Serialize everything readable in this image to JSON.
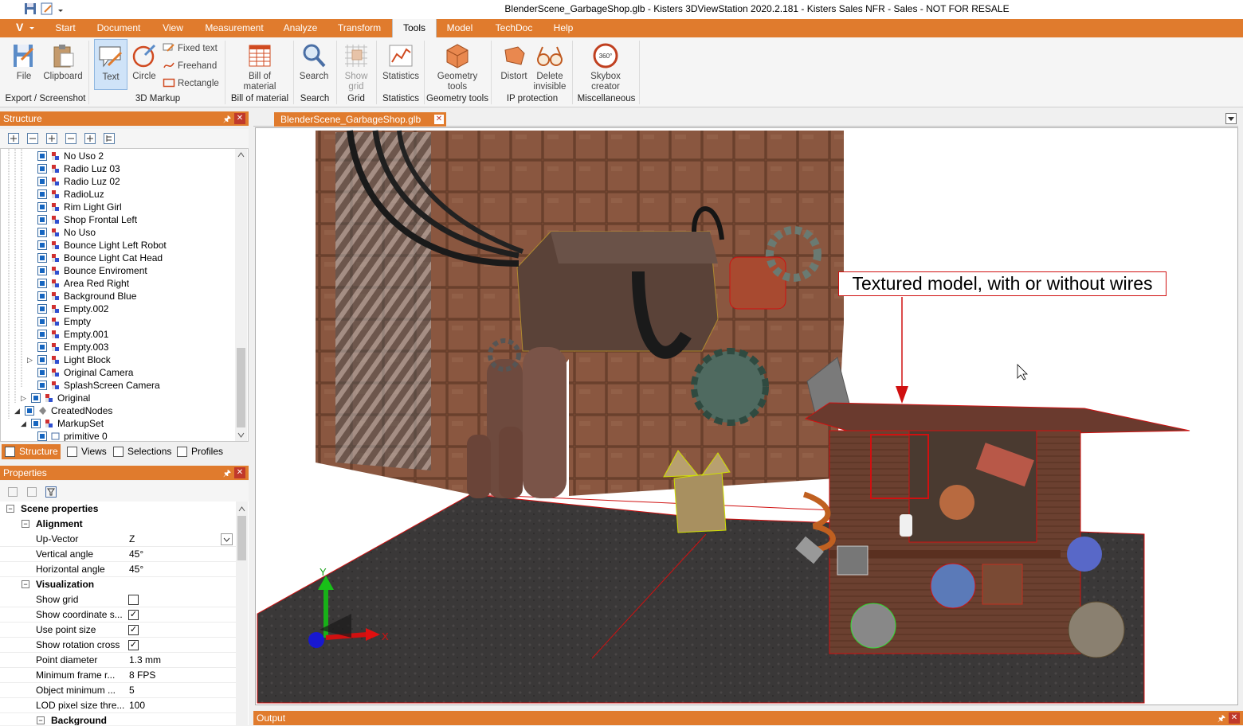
{
  "window": {
    "title": "BlenderScene_GarbageShop.glb - Kisters 3DViewStation 2020.2.181 - Kisters Sales NFR - Sales - NOT FOR RESALE"
  },
  "ribbon_tabs": [
    "Start",
    "Document",
    "View",
    "Measurement",
    "Analyze",
    "Transform",
    "Tools",
    "Model",
    "TechDoc",
    "Help"
  ],
  "app_button": "V",
  "ribbon": {
    "file": "File",
    "clipboard": "Clipboard",
    "text": "Text",
    "circle": "Circle",
    "fixed_text": "Fixed text",
    "freehand": "Freehand",
    "rectangle": "Rectangle",
    "bill_line1": "Bill of",
    "bill_line2": "material",
    "search": "Search",
    "show_grid_line1": "Show",
    "show_grid_line2": "grid",
    "statistics": "Statistics",
    "geom_line1": "Geometry",
    "geom_line2": "tools",
    "distort": "Distort",
    "delete_line1": "Delete",
    "delete_line2": "invisible",
    "skybox_line1": "Skybox",
    "skybox_line2": "creator",
    "groups": {
      "export": "Export / Screenshot",
      "markup": "3D Markup",
      "bill": "Bill of material",
      "search": "Search",
      "grid": "Grid",
      "statistics": "Statistics",
      "geometry": "Geometry tools",
      "ip": "IP protection",
      "misc": "Miscellaneous"
    }
  },
  "structure": {
    "title": "Structure",
    "items": [
      "No Uso 2",
      "Radio Luz 03",
      "Radio Luz 02",
      "RadioLuz",
      "Rim Light Girl",
      "Shop Frontal Left",
      "No Uso",
      "Bounce Light Left Robot",
      "Bounce Light Cat Head",
      "Bounce Enviroment",
      "Area Red Right",
      "Background Blue",
      "Empty.002",
      "Empty",
      "Empty.001",
      "Empty.003",
      "Light Block",
      "Original Camera",
      "SplashScreen Camera",
      "Original",
      "CreatedNodes",
      "MarkupSet",
      "primitive 0"
    ]
  },
  "panel_tabs": [
    "Structure",
    "Views",
    "Selections",
    "Profiles"
  ],
  "properties": {
    "title": "Properties",
    "scene": "Scene properties",
    "alignment": "Alignment",
    "up_vector_label": "Up-Vector",
    "up_vector_value": "Z",
    "vertical_angle_label": "Vertical angle",
    "vertical_angle_value": "45°",
    "horizontal_angle_label": "Horizontal angle",
    "horizontal_angle_value": "45°",
    "visualization": "Visualization",
    "show_grid_label": "Show grid",
    "show_grid_checked": false,
    "show_coord_label": "Show coordinate s...",
    "show_coord_checked": true,
    "use_point_label": "Use point size",
    "use_point_checked": true,
    "show_rot_label": "Show rotation cross",
    "show_rot_checked": true,
    "point_diam_label": "Point diameter",
    "point_diam_value": "1.3 mm",
    "min_frame_label": "Minimum frame r...",
    "min_frame_value": "8 FPS",
    "obj_min_label": "Object minimum ...",
    "obj_min_value": "5",
    "lod_label": "LOD pixel size thre...",
    "lod_value": "100",
    "background": "Background"
  },
  "document_tab": "BlenderScene_GarbageShop.glb",
  "viewport": {
    "callout": "Textured model, with or without wires",
    "axis_x": "X",
    "axis_y": "Y"
  },
  "output_title": "Output",
  "colors": {
    "accent": "#e07b2d",
    "callout_border": "#d01010",
    "check_blue": "#1565c0"
  }
}
